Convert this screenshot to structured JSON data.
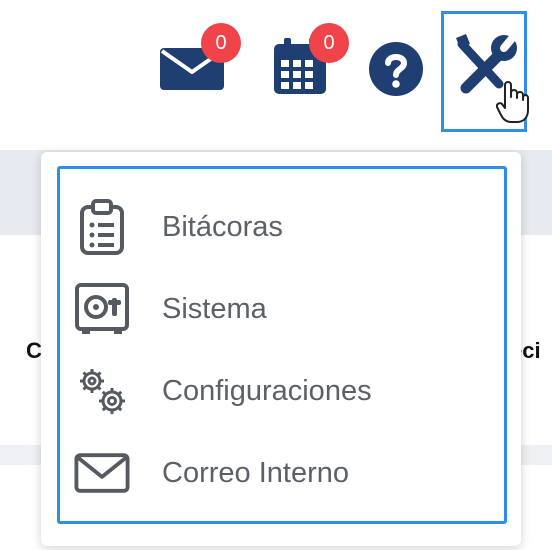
{
  "topbar": {
    "mail_badge": "0",
    "calendar_badge": "0",
    "help_icon": "help-icon",
    "tools_icon": "tools-icon"
  },
  "background": {
    "left_fragment": "C",
    "right_fragment": "eci"
  },
  "menu": {
    "items": [
      {
        "label": "Bitácoras",
        "icon": "clipboard-list-icon"
      },
      {
        "label": "Sistema",
        "icon": "safe-icon"
      },
      {
        "label": "Configuraciones",
        "icon": "gears-icon"
      },
      {
        "label": "Correo Interno",
        "icon": "envelope-icon"
      }
    ]
  },
  "colors": {
    "primary_dark_blue": "#1f3f73",
    "badge_red": "#f0444a",
    "highlight_blue": "#2f8fe8",
    "menu_text": "#5c6168",
    "menu_icon": "#555a61"
  }
}
